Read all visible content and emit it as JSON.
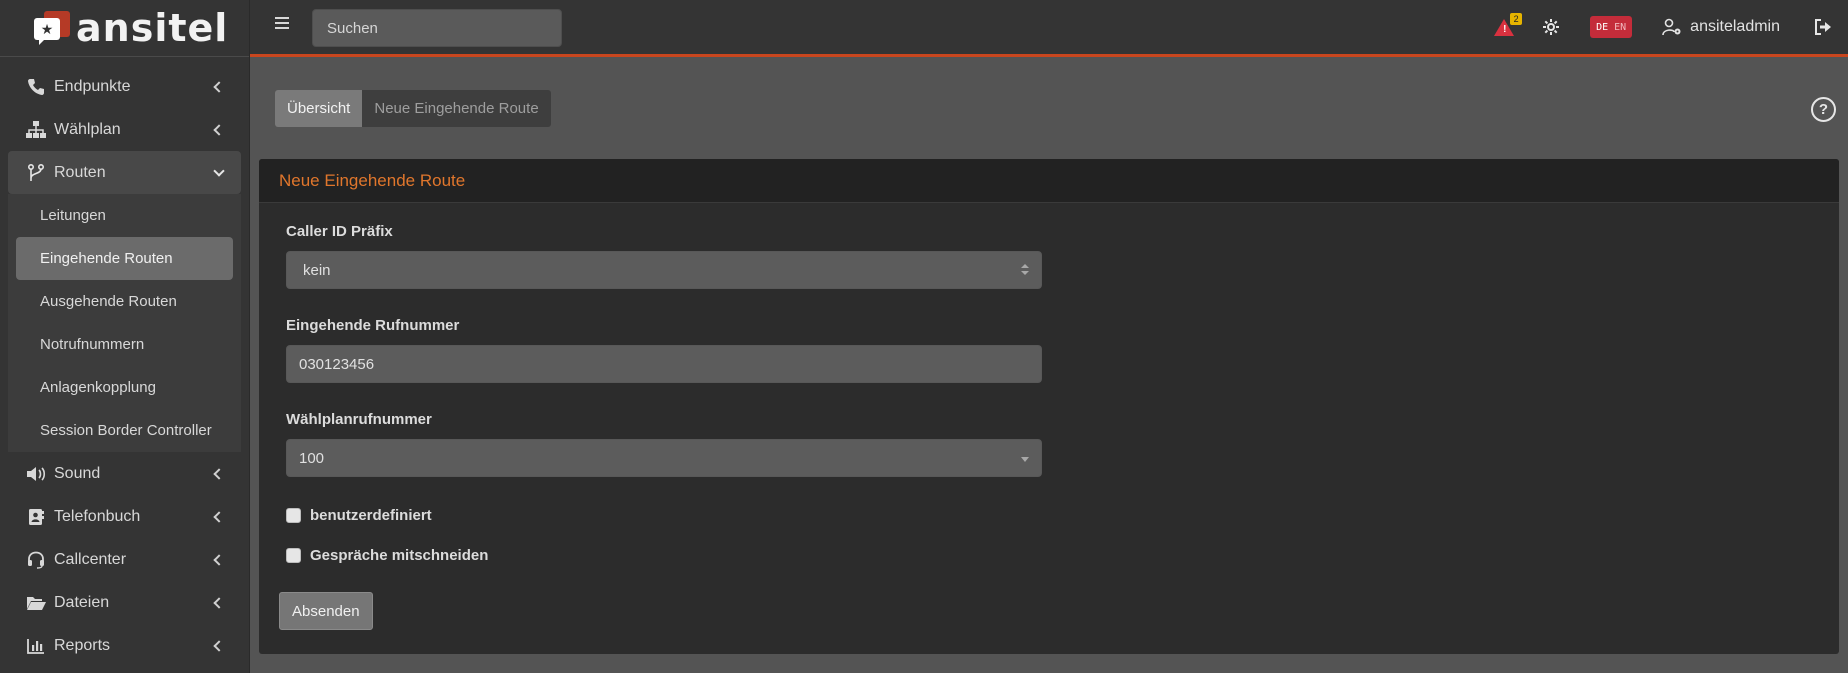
{
  "brand": {
    "name": "ansitel"
  },
  "topbar": {
    "search_placeholder": "Suchen",
    "alert_count": "2",
    "lang_active": "DE",
    "lang_inactive": "EN",
    "username": "ansiteladmin"
  },
  "sidebar": {
    "items": [
      {
        "label": "Endpunkte",
        "icon": "phone-icon"
      },
      {
        "label": "Wählplan",
        "icon": "sitemap-icon"
      },
      {
        "label": "Routen",
        "icon": "branch-icon"
      },
      {
        "label": "Sound",
        "icon": "volume-icon"
      },
      {
        "label": "Telefonbuch",
        "icon": "address-book-icon"
      },
      {
        "label": "Callcenter",
        "icon": "headset-icon"
      },
      {
        "label": "Dateien",
        "icon": "folder-open-icon"
      },
      {
        "label": "Reports",
        "icon": "chart-icon"
      }
    ],
    "routen_sub": [
      "Leitungen",
      "Eingehende Routen",
      "Ausgehende Routen",
      "Notrufnummern",
      "Anlagenkopplung",
      "Session Border Controller"
    ]
  },
  "tabs": {
    "overview": "Übersicht",
    "new_route": "Neue Eingehende Route"
  },
  "card": {
    "title": "Neue Eingehende Route",
    "caller_id_label": "Caller ID Präfix",
    "caller_id_value": "kein",
    "incoming_label": "Eingehende Rufnummer",
    "incoming_value": "030123456",
    "dialplan_label": "Wählplanrufnummer",
    "dialplan_value": "100",
    "custom_label": "benutzerdefiniert",
    "record_label": "Gespräche mitschneiden",
    "submit_label": "Absenden"
  },
  "colors": {
    "accent": "#e0762c",
    "topbar_border": "#c9461e",
    "alert": "#d9313f",
    "lang": "#c42c3a"
  }
}
